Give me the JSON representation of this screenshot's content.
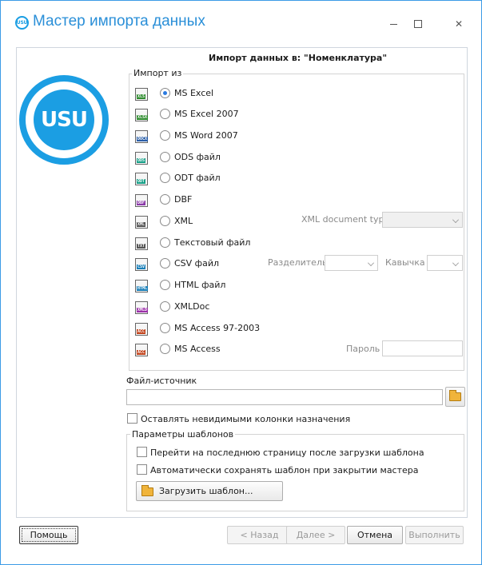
{
  "window": {
    "title": "Мастер импорта данных",
    "app_icon_text": "USU",
    "accent": "#1b9ee3"
  },
  "logo": {
    "text": "USU"
  },
  "header": {
    "title": "Импорт данных в: \"Номенклатура\""
  },
  "import": {
    "legend": "Импорт из",
    "options": [
      {
        "label": "MS Excel",
        "tag": "XLS",
        "tag_color": "#2e8b2e",
        "checked": true
      },
      {
        "label": "MS Excel 2007",
        "tag": "XLSX",
        "tag_color": "#2e8b2e",
        "checked": false
      },
      {
        "label": "MS Word 2007",
        "tag": "DOCX",
        "tag_color": "#2a5ea8",
        "checked": false
      },
      {
        "label": "ODS файл",
        "tag": "ODS",
        "tag_color": "#18a088",
        "checked": false
      },
      {
        "label": "ODT файл",
        "tag": "ODT",
        "tag_color": "#18a088",
        "checked": false
      },
      {
        "label": "DBF",
        "tag": "DBF",
        "tag_color": "#8a3aa8",
        "checked": false
      },
      {
        "label": "XML",
        "tag": "XML",
        "tag_color": "#555555",
        "checked": false
      },
      {
        "label": "Текстовый файл",
        "tag": "TXT",
        "tag_color": "#555555",
        "checked": false
      },
      {
        "label": "CSV файл",
        "tag": "CSV",
        "tag_color": "#1a7fb8",
        "checked": false
      },
      {
        "label": "HTML файл",
        "tag": "HTML",
        "tag_color": "#1a7fb8",
        "checked": false
      },
      {
        "label": "XMLDoc",
        "tag": "XMLD",
        "tag_color": "#9b2fa8",
        "checked": false
      },
      {
        "label": "MS Access 97-2003",
        "tag": "ACC",
        "tag_color": "#c2451e",
        "checked": false
      },
      {
        "label": "MS Access",
        "tag": "ACC",
        "tag_color": "#c2451e",
        "checked": false
      }
    ],
    "xml_document_type_label": "XML document type",
    "xml_document_type_value": "",
    "separator_label": "Разделитель",
    "separator_value": "",
    "quote_label": "Кавычка",
    "quote_value": "",
    "password_label": "Пароль",
    "password_value": ""
  },
  "source": {
    "label": "Файл-источник",
    "value": ""
  },
  "keep_invisible": {
    "label": "Оставлять невидимыми колонки назначения",
    "checked": false
  },
  "templates": {
    "legend": "Параметры шаблонов",
    "goto_last_page": {
      "label": "Перейти на последнюю страницу после загрузки шаблона",
      "checked": false
    },
    "auto_save": {
      "label": "Автоматически сохранять шаблон при закрытии мастера",
      "checked": false
    },
    "load_button": "Загрузить шаблон..."
  },
  "footer": {
    "help": "Помощь",
    "back": "< Назад",
    "next": "Далее >",
    "cancel": "Отмена",
    "finish": "Выполнить"
  }
}
